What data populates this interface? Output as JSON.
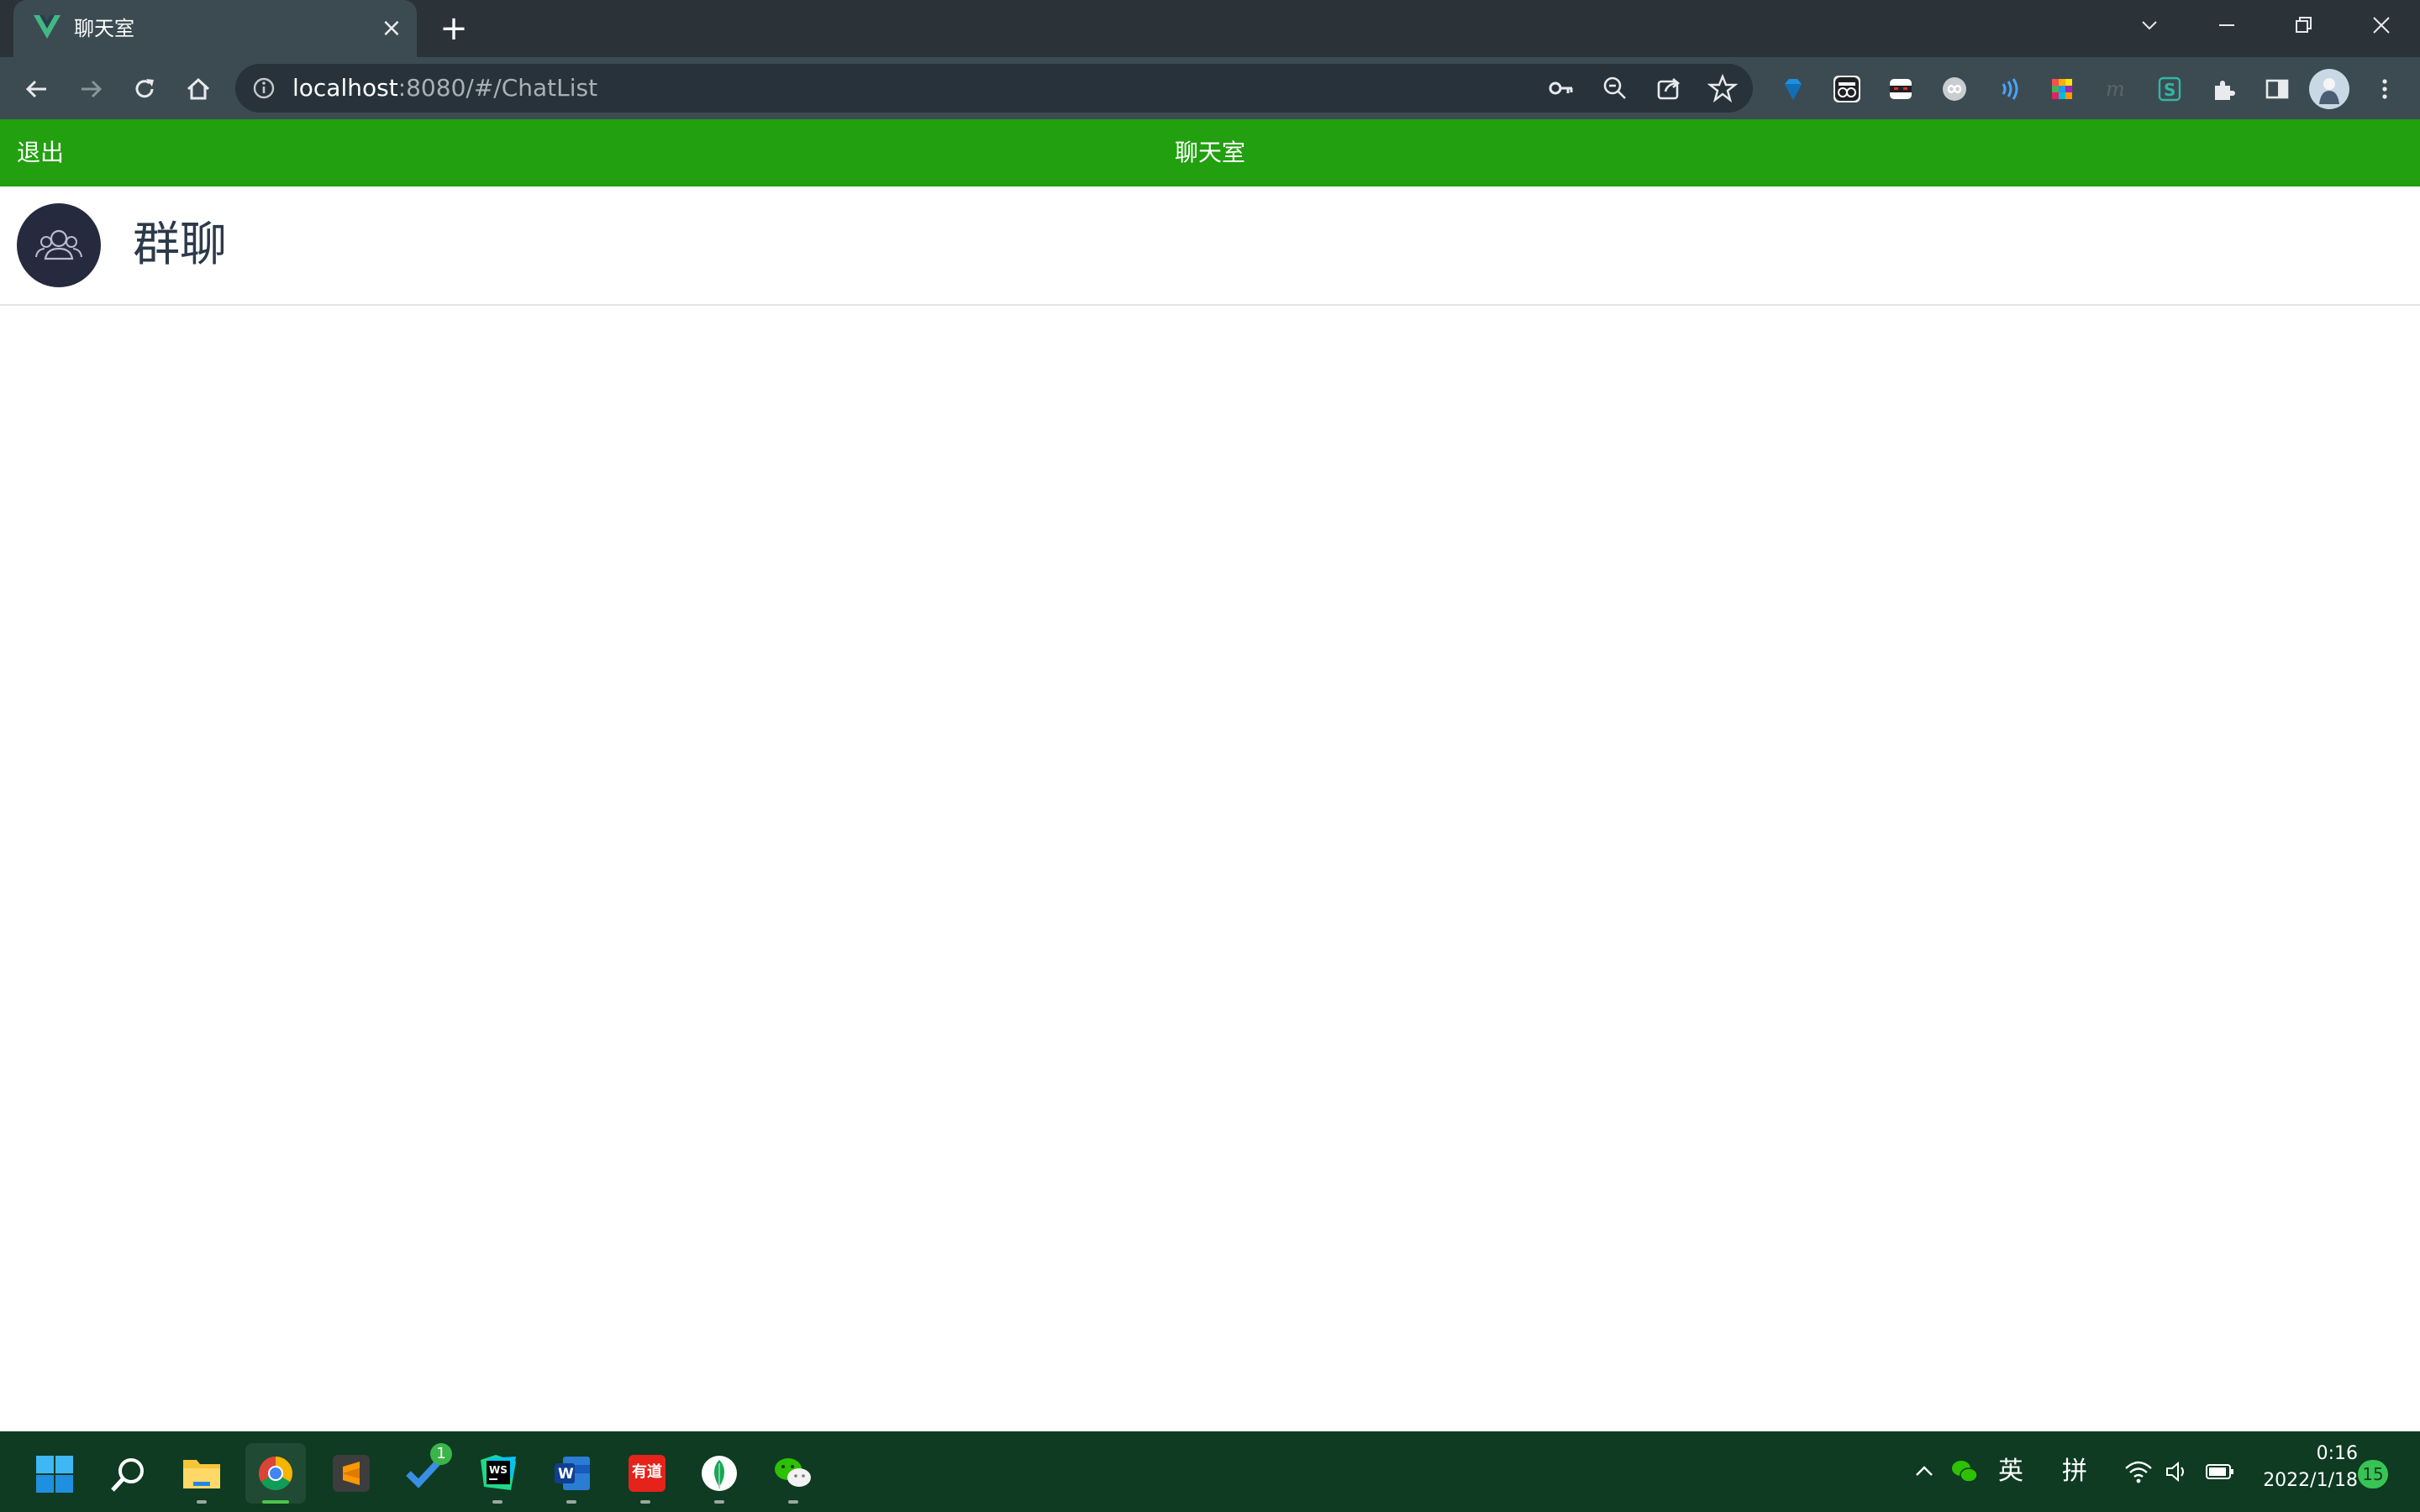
{
  "browser": {
    "tab_title": "聊天室",
    "url_host": "localhost",
    "url_path": ":8080/#/ChatList"
  },
  "page": {
    "logout_label": "退出",
    "title": "聊天室"
  },
  "chats": [
    {
      "name": "群聊"
    }
  ],
  "taskbar": {
    "todo_badge": "1",
    "tray_lang": "英",
    "tray_ime": "拼",
    "time": "0:16",
    "date": "2022/1/18",
    "notifications": "15"
  },
  "colors": {
    "header_green": "#22a010",
    "avatar_bg": "#252a3e",
    "taskbar_bg": "#0e3b22"
  }
}
